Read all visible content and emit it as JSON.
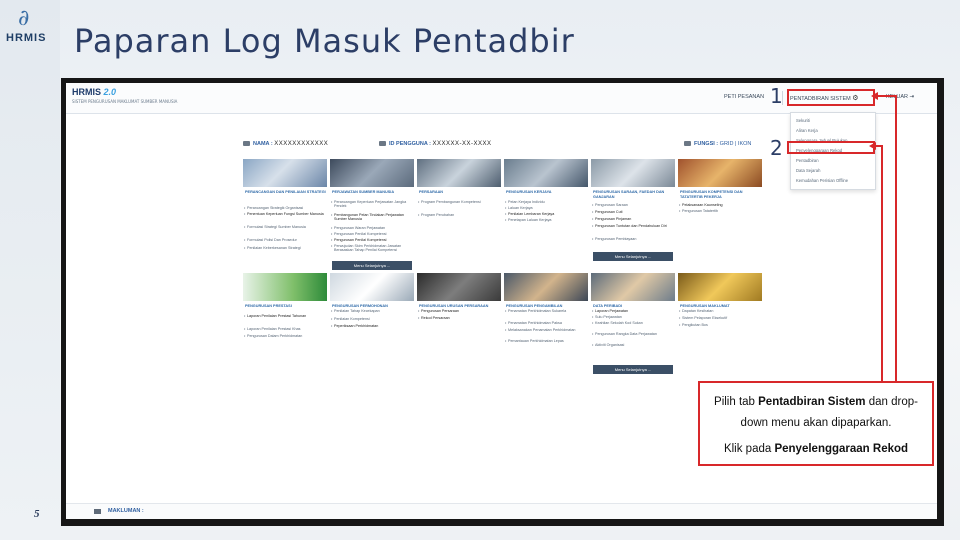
{
  "slide": {
    "title": "Paparan Log Masuk Pentadbir",
    "page_number": "5",
    "logo_text": "HRMIS",
    "step1": "1",
    "step2": "2"
  },
  "app": {
    "brand": "HRMIS",
    "version": "2.0",
    "brand_subtitle": "SISTEM PENGURUSAN MAKLUMAT SUMBER MANUSIA",
    "header": {
      "peti_pesanan": "PETI PESANAN",
      "pentadbiran_sistem": "PENTADBIRAN SISTEM",
      "keluar": "KELUAR"
    },
    "dropdown_items": [
      "Sekuriti",
      "Aliran Kerja",
      "Selenggara Jadual Rujukan",
      "Penyelenggaraan Rekod",
      "Pentadbiran",
      "Data Sejarah",
      "Kemudahan Perisian Offline"
    ],
    "info": {
      "nama_label": "NAMA :",
      "nama_value": "XXXXXXXXXXXX",
      "id_label": "ID PENGGUNA :",
      "id_value": "XXXXXX-XX-XXXX",
      "fungsi_label": "FUNGSI :",
      "fungsi_grid": "GRID",
      "fungsi_sep": "|",
      "fungsi_ikon": "IKON"
    },
    "tiles_row1": [
      {
        "title": "PERANCANGAN DAN PENILAIAN STRATEGI",
        "items": [
          "Perancangan Strategik Organisasi",
          "Penentuan Keperluan Fungsi Sumber Manusia",
          "Formulasi Strategi Sumber Manusia",
          "Formulasi Polisi Dan Prosedur",
          "Penilaian Keberkesanan Strategi"
        ]
      },
      {
        "title": "PERJAWATAN SUMBER MANUSIA",
        "items": [
          "Perancangan Keperluan Perjawatan Jangka Pendek",
          "Pembangunan Pelan Tindakan Perjawatan Sumber Manusia",
          "Pengurusan Waran Perjawatan",
          "Pengurusan Penilai Kompetensi",
          "Pengurusan Penilai Kompetensi",
          "Perwujudan Skim Perkhidmatan Jawatan Berasaskan Tahap Penilai Kompetensi"
        ]
      },
      {
        "title": "PERSARAAN",
        "items": [
          "Program Pembangunan Kompetensi",
          "Program Perubahan"
        ]
      },
      {
        "title": "PENGURUSAN KERJAYA",
        "items": [
          "Pelan Kerjaya Individu",
          "Laluan Kerjaya",
          "Penilaian Lembaran Kerjaya",
          "Penetapan Laluan Kerjaya"
        ]
      },
      {
        "title": "PENGURUSAN SARAAN, FAEDAH DAN GANJARAN",
        "items": [
          "Pengurusan Saraan",
          "Pengurusan Cuti",
          "Pengurusan Pinjaman",
          "Pengurusan Tuntutan dan Pendahuluan Diri",
          "Pengurusan Pembiayaan"
        ]
      },
      {
        "title": "PENGURUSAN KOMPETENSI DAN TATATERTIB PEKERJA",
        "items": [
          "Pelaksanaan Kaunseling",
          "Pengurusan Tatatertib"
        ]
      }
    ],
    "more_label": "Menu Selanjutnya ...",
    "tiles_row2": [
      {
        "title": "PENGURUSAN PRESTASI",
        "items": [
          "Laporan Penilaian Prestasi Tahunan",
          "Laporan Penilaian Prestasi Khas",
          "Pengurusan Dalam Perkhidmatan"
        ]
      },
      {
        "title": "PENGURUSAN PERMOHONAN",
        "items": [
          "Penilaian Tahap Kecekapan",
          "Penilaian Kompetensi",
          "Peperiksaan Perkhidmatan"
        ]
      },
      {
        "title": "PENGURUSAN URUSAN PERSARAAN",
        "items": [
          "Pengurusan Persaraan",
          "Rekod Persaraan"
        ]
      },
      {
        "title": "PENGURUSAN PENGAMBILAN",
        "items": [
          "Penamatan Perkhidmatan Sukarela",
          "Penamatan Perkhidmatan Paksa",
          "Melaksanakan Penamatan Perkhidmatan",
          "Pemantauan Perkhidmatan Lepas"
        ]
      },
      {
        "title": "DATA PERIBADI",
        "items": [
          "Laporan Perjawatan",
          "Sulu Perjawatan",
          "Keahlian Sekolah Kod Sukan",
          "Pengurusan Rangka Data Perjawatan",
          "Aktiviti Organisasi"
        ]
      },
      {
        "title": "PENGURUSAN MAKLUMAT",
        "items": [
          "Dapatan Kesihatan",
          "Sistem Pelaporan Eksekutif",
          "Pengikutan Bos"
        ]
      }
    ],
    "footer_label": "MAKLUMAN :"
  },
  "callout": {
    "line1_pre": "Pilih tab ",
    "line1_bold": "Pentadbiran Sistem",
    "line1_post": " dan drop-",
    "line2": "down menu akan dipaparkan.",
    "line3_pre": "Klik pada ",
    "line3_bold": "Penyelenggaraan Rekod"
  },
  "colors": {
    "highlight": "#d8282a",
    "title": "#2c3e66",
    "link": "#2f5fa0"
  }
}
